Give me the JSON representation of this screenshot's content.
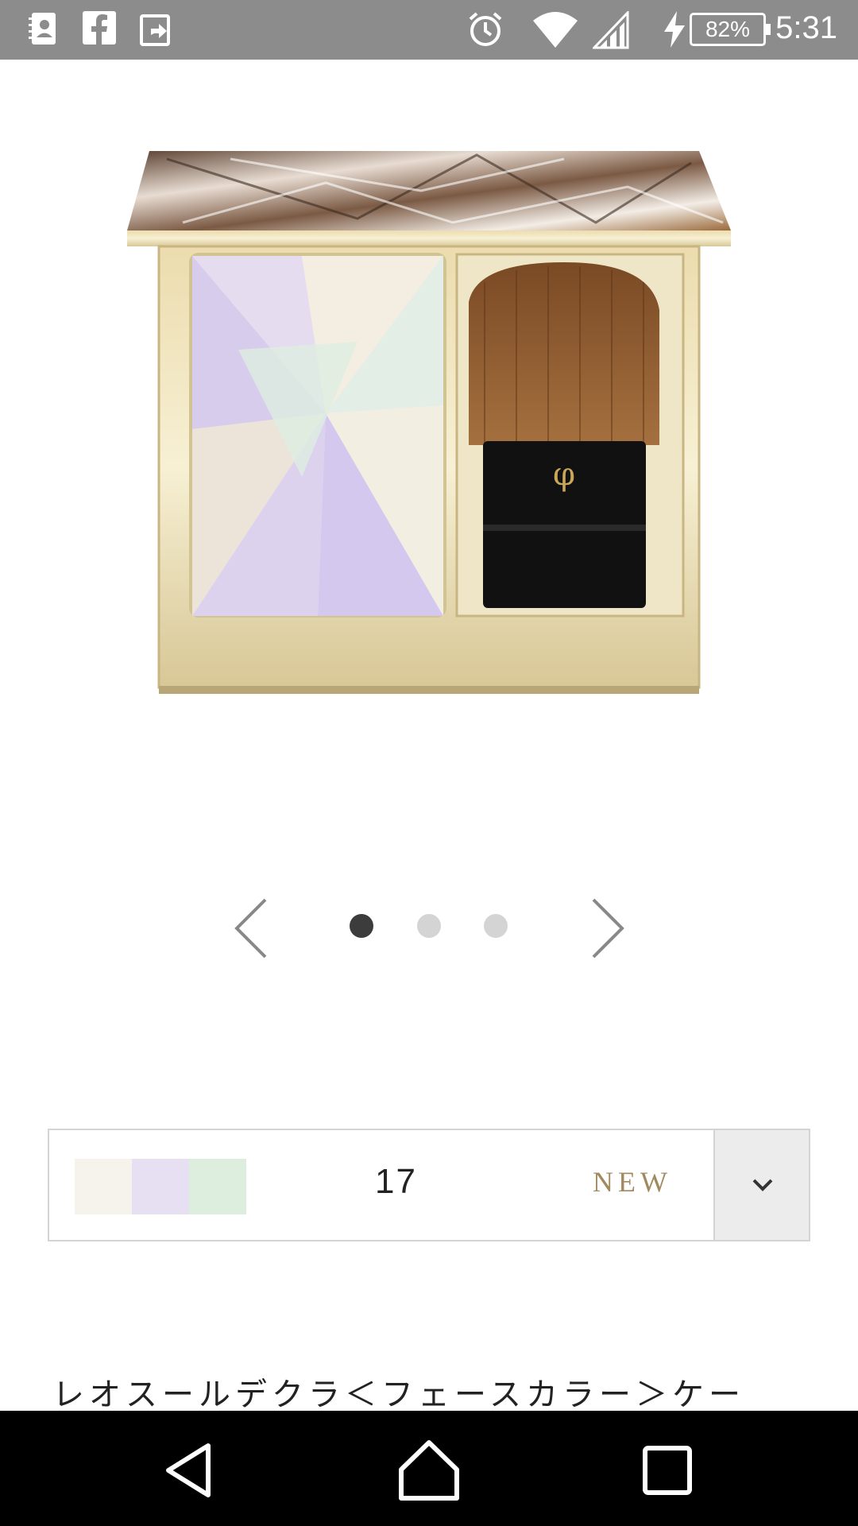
{
  "status_bar": {
    "left_icons": [
      "contacts-icon",
      "facebook-icon",
      "share-icon"
    ],
    "right_icons": [
      "alarm-icon",
      "wifi-icon",
      "signal-icon",
      "charging-icon"
    ],
    "battery": "82%",
    "time": "5:31"
  },
  "product_image": {
    "icon": "compact-palette-image"
  },
  "carousel": {
    "prev_icon": "chevron-left-icon",
    "next_icon": "chevron-right-icon",
    "total": 3,
    "active_index": 0
  },
  "shade_selector": {
    "swatch_colors": [
      "#f6f2ec",
      "#e6e0f2",
      "#deeede"
    ],
    "shade_number": "17",
    "badge": "NEW",
    "dropdown_icon": "chevron-down-icon"
  },
  "product": {
    "title": "レオスールデクラ＜フェースカラー＞ケー"
  },
  "nav_bar": {
    "back_icon": "back-triangle-icon",
    "home_icon": "home-icon",
    "recents_icon": "recents-square-icon"
  }
}
